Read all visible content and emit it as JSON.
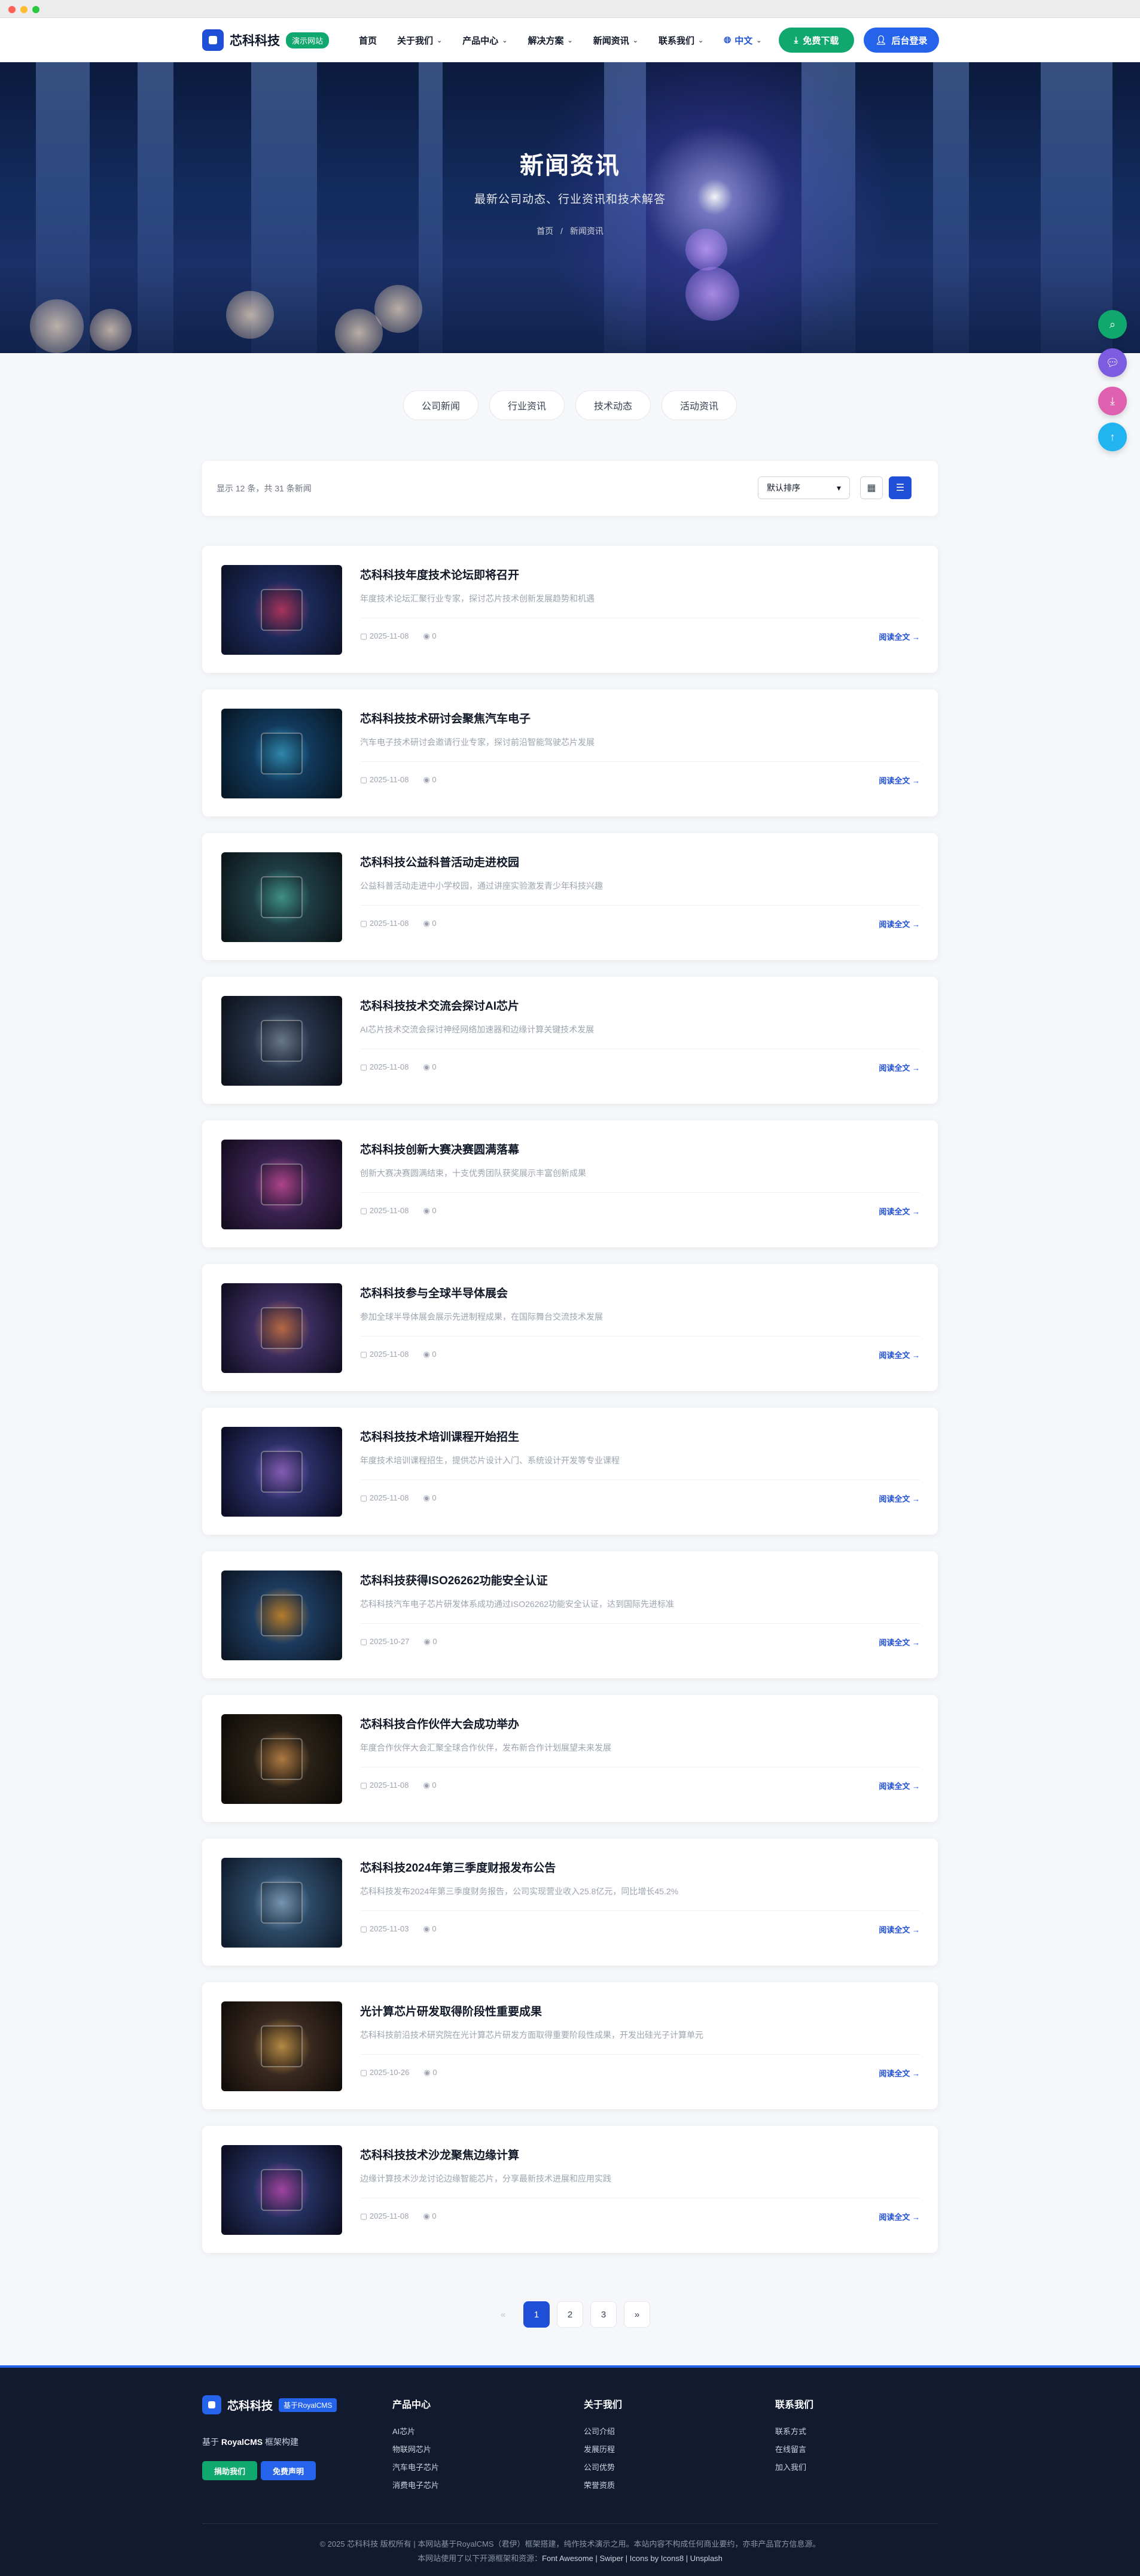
{
  "header": {
    "logo_text": "芯科科技",
    "logo_badge": "演示网站",
    "nav": [
      {
        "label": "首页",
        "has_dropdown": false
      },
      {
        "label": "关于我们",
        "has_dropdown": true
      },
      {
        "label": "产品中心",
        "has_dropdown": true
      },
      {
        "label": "解决方案",
        "has_dropdown": true
      },
      {
        "label": "新闻资讯",
        "has_dropdown": true
      },
      {
        "label": "联系我们",
        "has_dropdown": true
      }
    ],
    "language": "中文",
    "download_label": "免费下载",
    "admin_label": "后台登录"
  },
  "hero": {
    "title": "新闻资讯",
    "subtitle": "最新公司动态、行业资讯和技术解答",
    "breadcrumb_home": "首页",
    "breadcrumb_sep": "/",
    "breadcrumb_current": "新闻资讯"
  },
  "tabs": [
    "公司新闻",
    "行业资讯",
    "技术动态",
    "活动资讯"
  ],
  "toolbar": {
    "count_text": "显示 12 条，共 31 条新闻",
    "sort_label": "默认排序",
    "sort_chevron": "▾"
  },
  "read_more_label": "阅读全文 →",
  "articles": [
    {
      "title": "芯科科技年度技术论坛即将召开",
      "desc": "年度技术论坛汇聚行业专家，探讨芯片技术创新发展趋势和机遇",
      "date": "2025-11-08",
      "views": "0",
      "thumb_colors": [
        "#e0457b",
        "#1c2a5a",
        "#0b1124"
      ]
    },
    {
      "title": "芯科科技技术研讨会聚焦汽车电子",
      "desc": "汽车电子技术研讨会邀请行业专家，探讨前沿智能驾驶芯片发展",
      "date": "2025-11-08",
      "views": "0",
      "thumb_colors": [
        "#3fb4e6",
        "#123a5c",
        "#061521"
      ]
    },
    {
      "title": "芯科科技公益科普活动走进校园",
      "desc": "公益科普活动走进中小学校园，通过讲座实验激发青少年科技兴趣",
      "date": "2025-11-08",
      "views": "0",
      "thumb_colors": [
        "#56c1b2",
        "#1f3d44",
        "#0a1316"
      ]
    },
    {
      "title": "芯科科技技术交流会探讨AI芯片",
      "desc": "AI芯片技术交流会探讨神经网络加速器和边缘计算关键技术发展",
      "date": "2025-11-08",
      "views": "0",
      "thumb_colors": [
        "#8aa0b8",
        "#27344a",
        "#0b0f18"
      ]
    },
    {
      "title": "芯科科技创新大赛决赛圆满落幕",
      "desc": "创新大赛决赛圆满结束，十支优秀团队获奖展示丰富创新成果",
      "date": "2025-11-08",
      "views": "0",
      "thumb_colors": [
        "#e85bb8",
        "#3a2350",
        "#120b1c"
      ]
    },
    {
      "title": "芯科科技参与全球半导体展会",
      "desc": "参加全球半导体展会展示先进制程成果，在国际舞台交流技术发展",
      "date": "2025-11-08",
      "views": "0",
      "thumb_colors": [
        "#f28c5a",
        "#3b2d5e",
        "#0d0b1c"
      ]
    },
    {
      "title": "芯科科技技术培训课程开始招生",
      "desc": "年度技术培训课程招生，提供芯片设计入门、系统设计开发等专业课程",
      "date": "2025-11-08",
      "views": "0",
      "thumb_colors": [
        "#b07cf0",
        "#2b2f66",
        "#090a1e"
      ]
    },
    {
      "title": "芯科科技获得ISO26262功能安全认证",
      "desc": "芯科科技汽车电子芯片研发体系成功通过ISO26262功能安全认证，达到国际先进标准",
      "date": "2025-10-27",
      "views": "0",
      "thumb_colors": [
        "#f2a53c",
        "#1d3b5e",
        "#0b1420"
      ]
    },
    {
      "title": "芯科科技合作伙伴大会成功举办",
      "desc": "年度合作伙伴大会汇聚全球合作伙伴，发布新合作计划展望未来发展",
      "date": "2025-11-08",
      "views": "0",
      "thumb_colors": [
        "#e9a25a",
        "#2a2218",
        "#0c0906"
      ]
    },
    {
      "title": "芯科科技2024年第三季度财报发布公告",
      "desc": "芯科科技发布2024年第三季度财务报告，公司实现营业收入25.8亿元，同比增长45.2%",
      "date": "2025-11-03",
      "views": "0",
      "thumb_colors": [
        "#9ec6ea",
        "#2d4a66",
        "#0d1828"
      ]
    },
    {
      "title": "光计算芯片研发取得阶段性重要成果",
      "desc": "芯科科技前沿技术研究院在光计算芯片研发方面取得重要阶段性成果，开发出硅光子计算单元",
      "date": "2025-10-26",
      "views": "0",
      "thumb_colors": [
        "#f0b75a",
        "#3a2a20",
        "#0e0a08"
      ]
    },
    {
      "title": "芯科科技技术沙龙聚焦边缘计算",
      "desc": "边缘计算技术沙龙讨论边缘智能芯片，分享最新技术进展和应用实践",
      "date": "2025-11-08",
      "views": "0",
      "thumb_colors": [
        "#d65bd6",
        "#24305e",
        "#0a0b1c"
      ]
    }
  ],
  "pagination": {
    "prev": "«",
    "pages": [
      "1",
      "2",
      "3"
    ],
    "next": "»",
    "current": "1"
  },
  "footer": {
    "logo_text": "芯科科技",
    "logo_badge": "基于RoyalCMS",
    "tagline_prefix": "基于 ",
    "tagline_bold": "RoyalCMS",
    "tagline_suffix": " 框架构建",
    "btn_support": "捐助我们",
    "btn_license": "免费声明",
    "columns": [
      {
        "title": "产品中心",
        "links": [
          "AI芯片",
          "物联网芯片",
          "汽车电子芯片",
          "消费电子芯片"
        ]
      },
      {
        "title": "关于我们",
        "links": [
          "公司介绍",
          "发展历程",
          "公司优势",
          "荣誉资质"
        ]
      },
      {
        "title": "联系我们",
        "links": [
          "联系方式",
          "在线留言",
          "加入我们"
        ]
      }
    ],
    "copyright": "© 2025 芯科科技 版权所有 | 本网站基于RoyalCMS（君伊）框架搭建，纯作技术演示之用。本站内容不构成任何商业要约，亦非产品官方信息源。",
    "credits_prefix": "本网站使用了以下开源框架和资源：",
    "credits": "Font Awesome | Swiper | Icons by Icons8 | Unsplash"
  },
  "colors": {
    "primary": "#1f4fd6",
    "green": "#10a86e",
    "footer_bg": "#111a2e"
  }
}
